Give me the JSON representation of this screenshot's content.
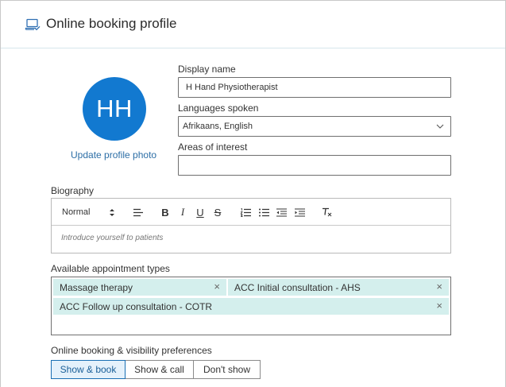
{
  "header": {
    "title": "Online booking profile",
    "icon": "laptop-check-icon"
  },
  "profile": {
    "initials": "HH",
    "avatar_color": "#1279d0",
    "update_photo_label": "Update profile photo"
  },
  "form": {
    "display_name": {
      "label": "Display name",
      "value": "H Hand Physiotherapist"
    },
    "languages": {
      "label": "Languages spoken",
      "value": "Afrikaans, English"
    },
    "areas": {
      "label": "Areas of interest",
      "value": ""
    },
    "biography": {
      "label": "Biography",
      "style_select": "Normal",
      "placeholder": "Introduce yourself to patients",
      "toolbar": [
        "up-down-arrows-icon",
        "align-icon",
        "bold-icon",
        "italic-icon",
        "underline-icon",
        "strikethrough-icon",
        "ordered-list-icon",
        "bullet-list-icon",
        "outdent-icon",
        "indent-icon",
        "clear-format-icon"
      ],
      "bold": "B",
      "italic": "I",
      "underline": "U",
      "strike": "S"
    },
    "appointment_types": {
      "label": "Available appointment types",
      "tags": [
        "Massage therapy",
        "ACC Initial consultation - AHS",
        "ACC Follow up consultation - COTR"
      ],
      "tag_color": "#d4efed"
    },
    "visibility": {
      "label": "Online booking & visibility preferences",
      "options": [
        "Show & book",
        "Show & call",
        "Don't show"
      ],
      "selected": "Show & book"
    }
  }
}
